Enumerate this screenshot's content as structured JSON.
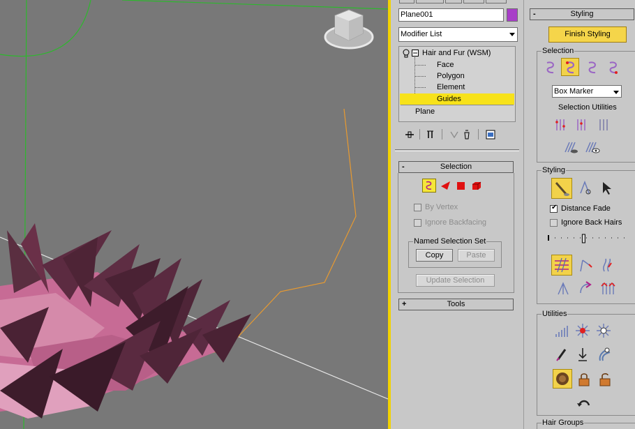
{
  "command_panel": {
    "object_name": "Plane001",
    "object_color": "#a83ec8",
    "modifier_list": "Modifier List",
    "stack": {
      "modifier": "Hair and Fur (WSM)",
      "subobjects": [
        "Face",
        "Polygon",
        "Element",
        "Guides"
      ],
      "selected_subobject": "Guides",
      "base_object": "Plane"
    },
    "stack_tools": [
      "pin-stack-icon",
      "show-end-result-icon",
      "make-unique-icon",
      "remove-modifier-icon",
      "configure-modifier-sets-icon"
    ],
    "selection_rollout": {
      "sign": "-",
      "title": "Selection",
      "subobject_icons": [
        "guides-icon",
        "face-icon",
        "polygon-icon",
        "element-icon"
      ],
      "by_vertex": "By Vertex",
      "ignore_backfacing": "Ignore Backfacing",
      "named_selection_set": "Named Selection Set",
      "copy": "Copy",
      "paste": "Paste",
      "update_selection": "Update Selection"
    },
    "tools_rollout": {
      "sign": "+",
      "title": "Tools"
    }
  },
  "styling_panel": {
    "header_sign": "-",
    "header": "Styling",
    "finish_styling": "Finish Styling",
    "selection_group": "Selection",
    "marker_dropdown": "Box Marker",
    "selection_utilities": "Selection Utilities",
    "styling_group": "Styling",
    "distance_fade": "Distance Fade",
    "distance_fade_checked": true,
    "ignore_back_hairs": "Ignore Back Hairs",
    "ignore_back_hairs_checked": false,
    "brush_slider_level": 0.45,
    "utilities_group": "Utilities",
    "hair_groups_group": "Hair Groups"
  },
  "viewport": {
    "background": "#787878",
    "accent_border": "#f2d200"
  }
}
